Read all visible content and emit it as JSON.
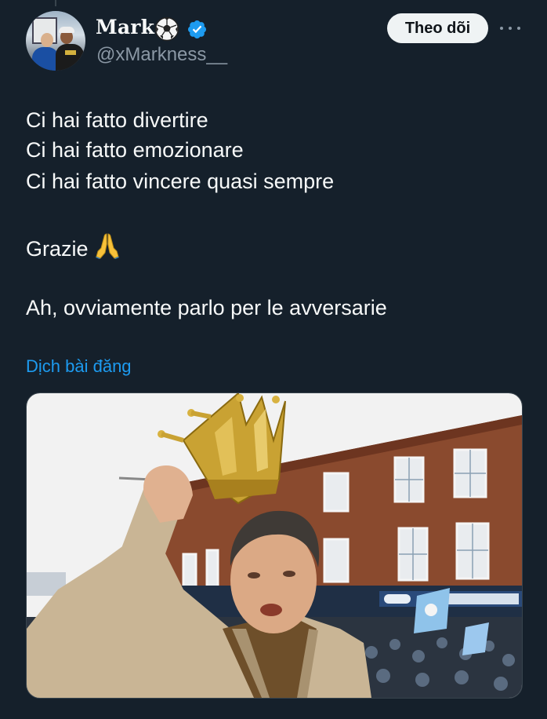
{
  "tweet": {
    "author": {
      "name": "Mark",
      "handle": "@xMarkness__",
      "name_emoji": "soccer-ball-icon",
      "verified": true,
      "verified_color": "#1d9bf0"
    },
    "follow_label": "Theo dõi",
    "more_icon": "more-horizontal-icon",
    "lines": [
      "Ci hai fatto divertire",
      "Ci hai fatto emozionare",
      "Ci hai fatto vincere quasi sempre",
      "Grazie",
      "Ah, ovviamente parlo per le avversarie"
    ],
    "grazie_emoji": "folded-hands-icon",
    "translate_label": "Dịch bài đăng",
    "media": {
      "kind": "photo",
      "description_icon": "photo-man-with-trophy-crown"
    }
  },
  "colors": {
    "background": "#15202b",
    "text": "#f7f9f9",
    "secondary_text": "#8b98a5",
    "link": "#1d9bf0",
    "follow_bg": "#eff3f4"
  }
}
